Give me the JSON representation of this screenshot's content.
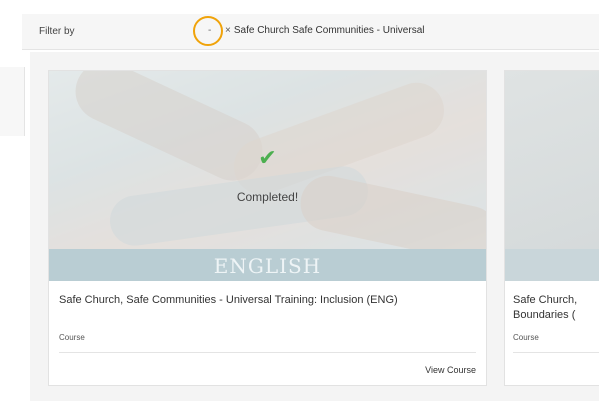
{
  "filter": {
    "label": "Filter by",
    "dash": "-",
    "remove_glyph": "×",
    "chip_text": "Safe Church Safe Communities - Universal"
  },
  "cards": [
    {
      "status_icon": "check-icon",
      "status_glyph": "✔",
      "status": "Completed!",
      "language": "ENGLISH",
      "title": "Safe Church, Safe Communities - Universal Training: Inclusion (ENG)",
      "type": "Course",
      "action": "View Course"
    },
    {
      "title": "Safe Church, Boundaries (",
      "type": "Course"
    }
  ],
  "colors": {
    "highlight": "#f0a30a",
    "check": "#4caf50",
    "language_band": "#b9cdd3"
  }
}
